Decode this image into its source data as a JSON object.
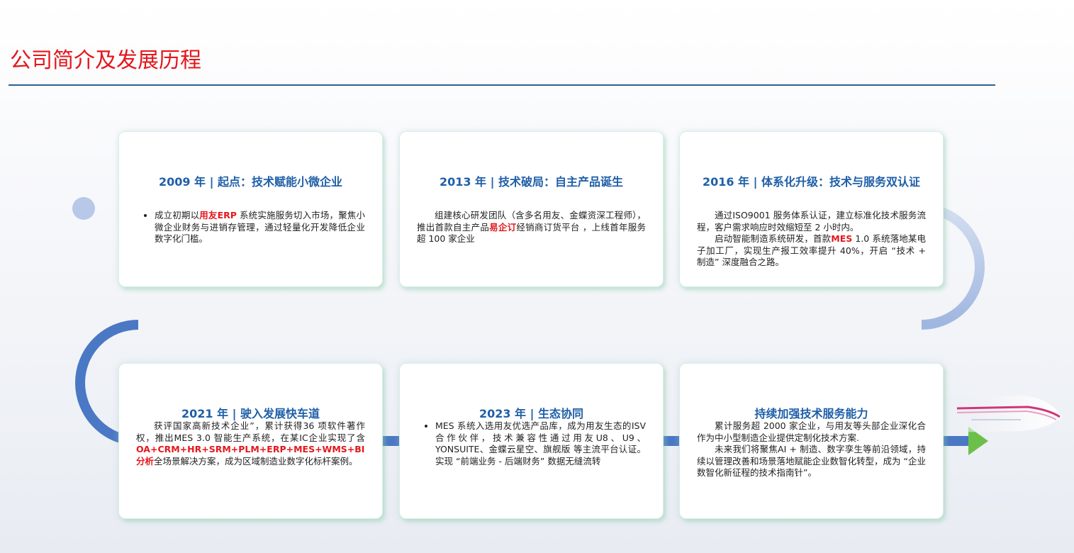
{
  "page": {
    "title": "公司简介及发展历程"
  },
  "colors": {
    "title_red": "#e4171c",
    "heading_blue": "#1f5fa8",
    "track_blue": "#4a78c4",
    "arrow_green": "#6cc04a",
    "highlight_red": "#e4171c"
  },
  "milestones": [
    {
      "heading": "2009 年 | 起点：技术赋能小微企业",
      "style": "bullet",
      "paragraphs": [
        {
          "segments": [
            {
              "text": "成立初期以"
            },
            {
              "text": "用友ERP",
              "highlight": true
            },
            {
              "text": " 系统实施服务切入市场，聚焦小微企业财务与进销存管理，通过轻量化开发降低企业数字化门槛。"
            }
          ]
        }
      ]
    },
    {
      "heading": "2013 年 | 技术破局：自主产品诞生",
      "style": "indent",
      "paragraphs": [
        {
          "segments": [
            {
              "text": "组建核心研发团队（含多名用友、金蝶资深工程师），推出首款自主产品"
            },
            {
              "text": "易企订",
              "highlight": true
            },
            {
              "text": "经销商订货平台 ，上线首年服务超 100 家企业"
            }
          ]
        }
      ]
    },
    {
      "heading": "2016 年 | 体系化升级：技术与服务双认证",
      "style": "indent",
      "paragraphs": [
        {
          "segments": [
            {
              "text": "通过ISO9001 服务体系认证，建立标准化技术服务流程，客户需求响应时效缩短至 2 小时内。"
            }
          ]
        },
        {
          "segments": [
            {
              "text": "启动智能制造系统研发，首款"
            },
            {
              "text": "MES",
              "highlight": true
            },
            {
              "text": " 1.0 系统落地某电子加工厂，实现生产报工效率提升 40%，开启 “技术 + 制造” 深度融合之路。"
            }
          ]
        }
      ]
    },
    {
      "heading": "2021 年 | 驶入发展快车道",
      "style": "indent",
      "paragraphs": [
        {
          "segments": [
            {
              "text": "获评国家高新技术企业”，累计获得36 项软件著作权，推出MES 3.0 智能生产系统，在某IC企业实现了含"
            },
            {
              "text": "OA+CRM+HR+SRM+PLM+ERP+MES+WMS+BI分析",
              "highlight": true
            },
            {
              "text": "全场景解决方案，成为区域制造业数字化标杆案例。"
            }
          ]
        }
      ]
    },
    {
      "heading": "2023 年 | 生态协同",
      "style": "bullet",
      "paragraphs": [
        {
          "segments": [
            {
              "text": "MES 系统入选用友优选产品库，成为用友生态的ISV 合作伙伴，技术兼容性通过用友U8、U9、YONSUITE、金蝶云星空、旗舰版 等主流平台认证。实现 “前端业务 - 后端财务” 数据无缝流转"
            }
          ]
        }
      ]
    },
    {
      "heading": "持续加强技术服务能力",
      "style": "indent",
      "paragraphs": [
        {
          "segments": [
            {
              "text": "累计服务超 2000 家企业，与用友等头部企业深化合作为中小型制造企业提供定制化技术方案."
            }
          ]
        },
        {
          "segments": [
            {
              "text": "未来我们将聚焦AI + 制造、数字孪生等前沿领域，持续以管理改善和场景落地赋能企业数智化转型，成为 “企业数智化新征程的技术指南针”。"
            }
          ]
        }
      ]
    }
  ]
}
